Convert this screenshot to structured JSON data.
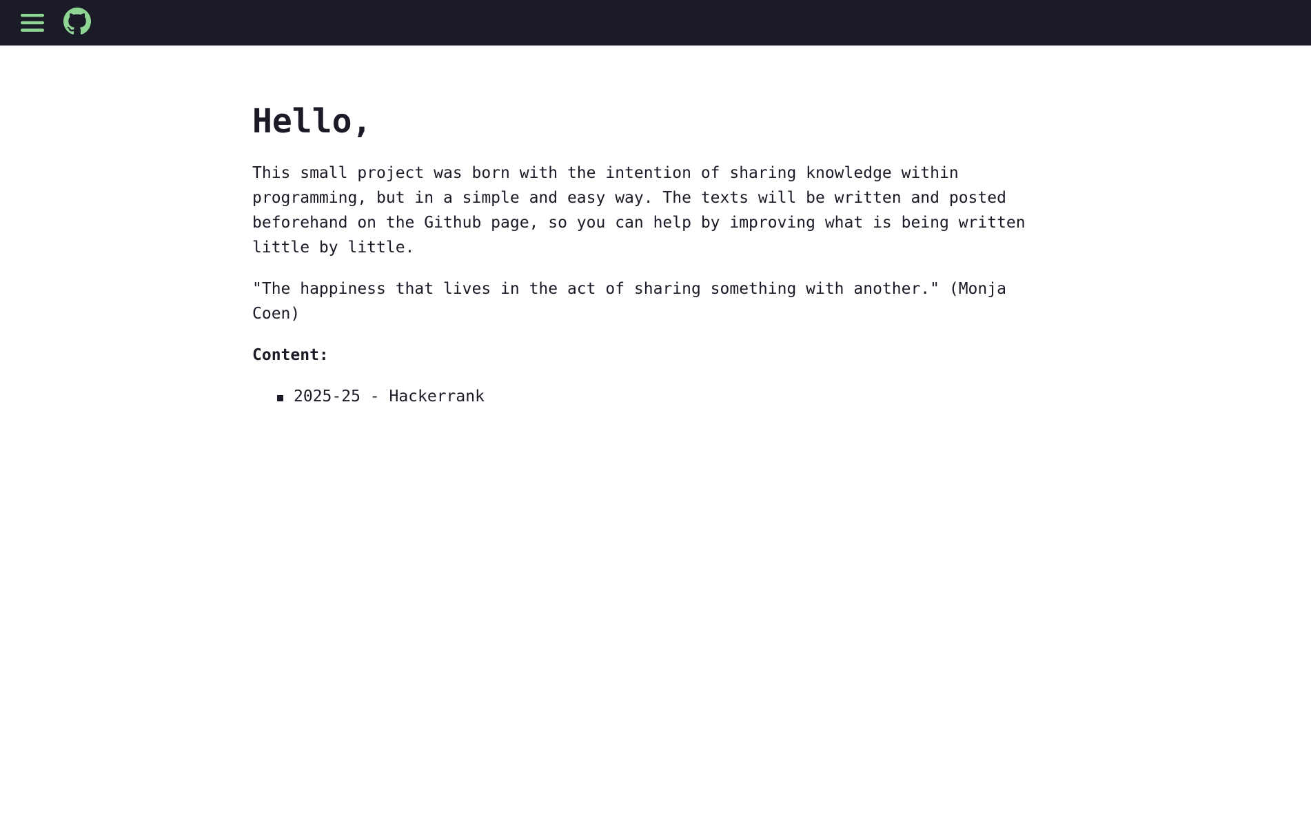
{
  "header": {
    "menu_icon": "hamburger-menu-icon",
    "github_icon": "github-icon",
    "accent_color": "#8fd694",
    "background_color": "#1a1b26"
  },
  "main": {
    "heading": "Hello,",
    "intro": "This small project was born with the intention of sharing knowledge within programming, but in a simple and easy way. The texts will be written and posted beforehand on the Github page, so you can help by improving what is being written little by little.",
    "quote": "\"The happiness that lives in the act of sharing something with another.\" (Monja Coen)",
    "content_label": "Content:",
    "posts": [
      {
        "label": "2025-25 - Hackerrank"
      }
    ]
  }
}
